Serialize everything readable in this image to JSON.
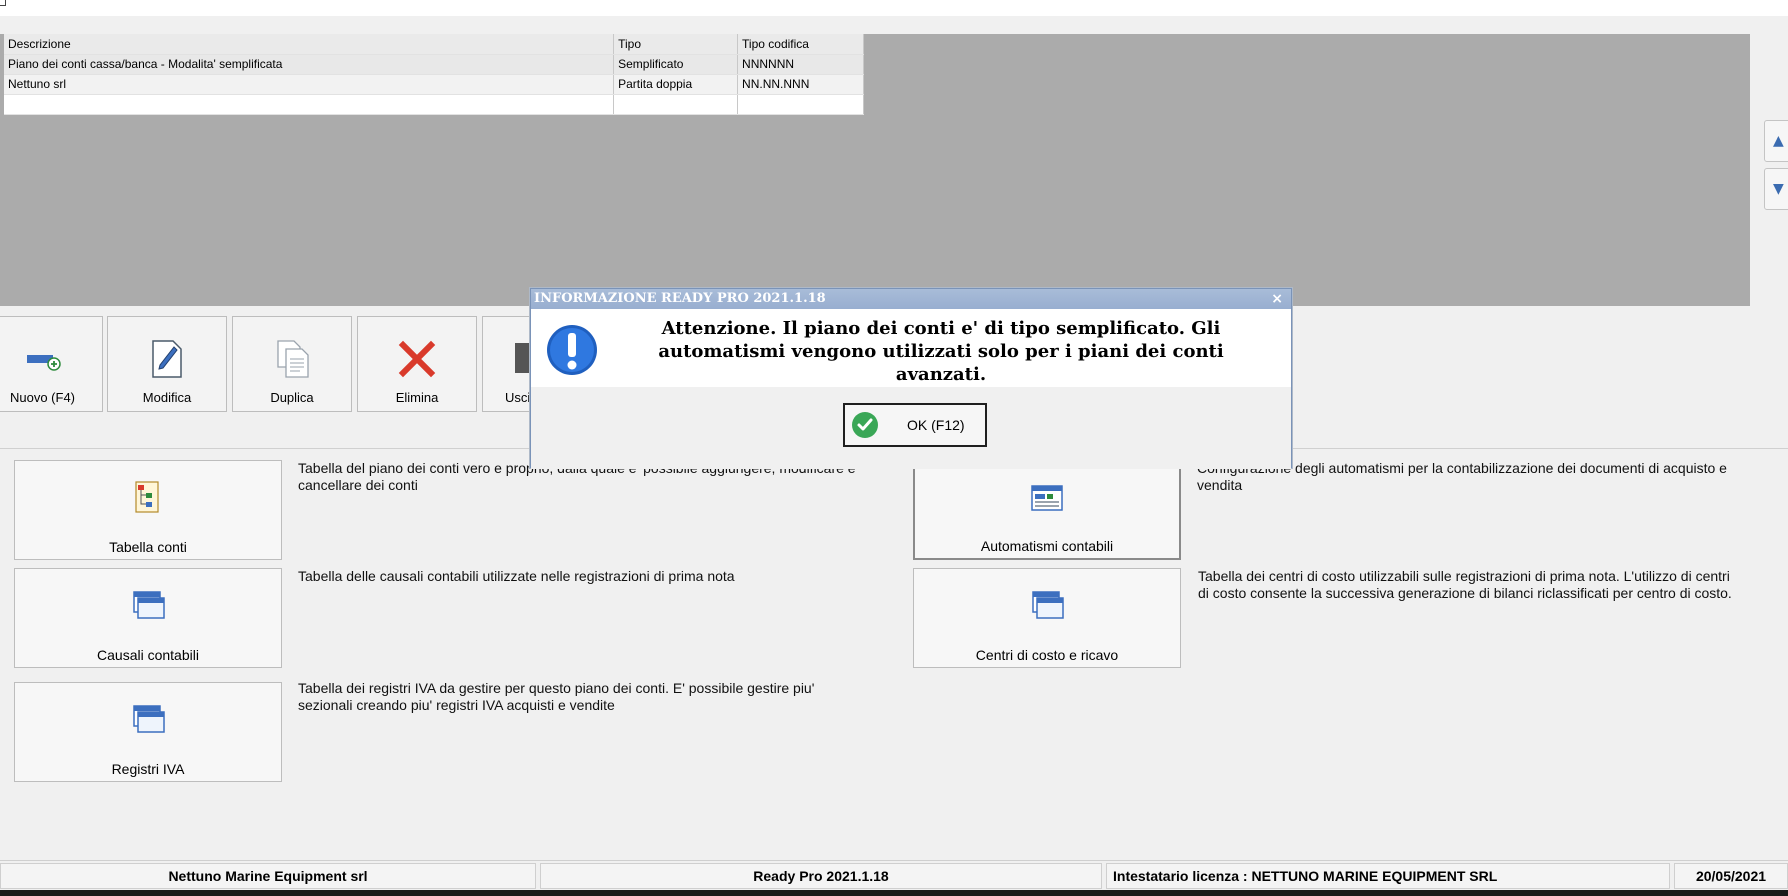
{
  "grid": {
    "headers": [
      "Descrizione",
      "Tipo",
      "Tipo codifica"
    ],
    "rows": [
      [
        "Piano dei conti cassa/banca - Modalita' semplificata",
        "Semplificato",
        "NNNNNN"
      ],
      [
        "Nettuno srl",
        "Partita doppia",
        "NN.NN.NNN"
      ]
    ]
  },
  "toolbar": {
    "nuovo": "Nuovo (F4)",
    "modifica": "Modifica",
    "duplica": "Duplica",
    "elimina": "Elimina",
    "esci": "Usci"
  },
  "tiles": {
    "tabella_conti": {
      "label": "Tabella conti",
      "desc": "Tabella del piano dei conti vero e proprio, dalla quale e' possibile aggiungere, modificare e cancellare dei conti"
    },
    "causali": {
      "label": "Causali contabili",
      "desc": "Tabella delle causali contabili utilizzate nelle registrazioni di prima nota"
    },
    "registri": {
      "label": "Registri IVA",
      "desc": "Tabella dei registri IVA da gestire per questo piano dei conti. E' possibile gestire piu' sezionali creando piu' registri IVA acquisti e vendite"
    },
    "automatismi": {
      "label": "Automatismi contabili",
      "desc": "Configurazione degli automatismi per la contabilizzazione dei documenti di acquisto e vendita"
    },
    "centri": {
      "label": "Centri di costo e ricavo",
      "desc": "Tabella dei centri di costo utilizzabili sulle registrazioni di prima nota. L'utilizzo di centri di costo consente la successiva generazione di bilanci riclassificati per centro di costo."
    }
  },
  "status": {
    "company": "Nettuno Marine Equipment srl",
    "product": "Ready Pro 2021.1.18",
    "license": "Intestatario licenza : NETTUNO MARINE EQUIPMENT SRL",
    "date": "20/05/2021"
  },
  "dialog": {
    "title": "INFORMAZIONE READY PRO 2021.1.18",
    "close": "×",
    "message": "Attenzione. Il piano dei conti e' di tipo semplificato. Gli automatismi vengono utilizzati solo per i piani dei conti avanzati.",
    "ok": "OK (F12)"
  },
  "icons": {
    "scroll_up": "chevron-up-icon",
    "scroll_down": "chevron-down-icon"
  }
}
